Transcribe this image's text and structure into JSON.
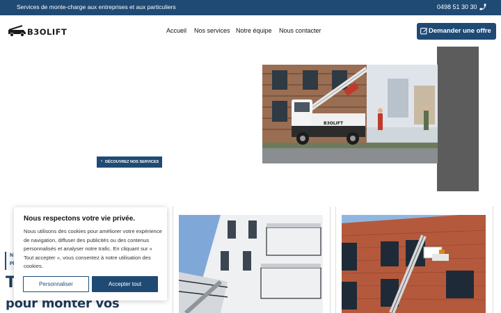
{
  "topbar": {
    "tagline": "Services de monte-charge aux entreprises et aux particuliers",
    "phone": "0498 51 30 30",
    "phone_icon": "phone-icon"
  },
  "header": {
    "logo_text": "B3OLIFT",
    "nav": {
      "accueil": "Accueil",
      "services": "Nos services",
      "equipe": "Notre équipe",
      "contact": "Nous contacter"
    },
    "cta_label": "Demander une offre",
    "cta_icon": "edit-icon"
  },
  "hero": {
    "button_label": "DÉCOUVREZ NOS SERVICES",
    "button_icon": "chevron-right-icon",
    "truck_brand": "B3OLIFT"
  },
  "behind": {
    "quote_text": "N\nPl",
    "heading_first_letter": "T",
    "heading_line": "pour monter vos"
  },
  "cookie": {
    "title": "Nous respectons votre vie privée.",
    "body": "Nous utilisons des cookies pour améliorer votre expérience de navigation, diffuser des publicités ou des contenus personnalisés et analyser notre trafic. En cliquant sur « Tout accepter », vous consentez à notre utilisation des cookies.",
    "customize_label": "Personnaliser",
    "accept_label": "Accepter tout"
  },
  "colors": {
    "brand_blue": "#1f4a74",
    "panel_gray": "#5c5c5c"
  }
}
